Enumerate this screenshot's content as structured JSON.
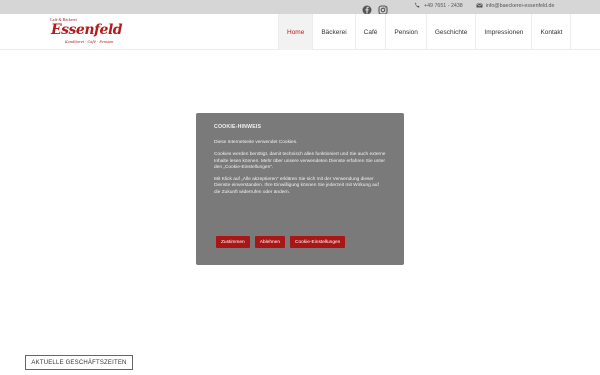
{
  "topbar": {
    "social": [
      {
        "icon": "facebook-icon"
      },
      {
        "icon": "instagram-icon"
      }
    ],
    "phone": "+49 7651 - 2438",
    "email": "info@baeckerei-essenfeld.de"
  },
  "logo": {
    "line1": "Café & Bäckerei",
    "name": "Essenfeld",
    "line3": "Konditorei · Café · Pension"
  },
  "nav": {
    "items": [
      "Home",
      "Bäckerei",
      "Café",
      "Pension",
      "Geschichte",
      "Impressionen",
      "Kontakt"
    ],
    "active": "Home"
  },
  "cookie": {
    "title": "COOKIE-HINWEIS",
    "p1": "Diese Internetseite verwendet Cookies.",
    "p2": "Cookies werden benötigt, damit technisch alles funktioniert und Sie auch externe Inhalte lesen können. Mehr über unsere verwendeten Dienste erfahren Sie unter den „Cookie-Einstellungen“.",
    "p3": "Mit Klick auf „Alle akzeptieren“ erklären Sie sich mit der Verwendung dieser Dienste einverstanden. Ihre Einwilligung können Sie jederzeit mit Wirkung auf die Zukunft widerrufen oder ändern.",
    "buttons": {
      "accept": "Zustimmen",
      "reject": "Ablehnen",
      "settings": "Cookie-Einstellungen"
    }
  },
  "hours_button": "AKTUELLE GESCHÄFTSZEITEN",
  "colors": {
    "accent": "#c2181e",
    "button": "#a81616",
    "dialog_bg": "#7a7a7a",
    "topbar_bg": "#d6d6d6"
  }
}
